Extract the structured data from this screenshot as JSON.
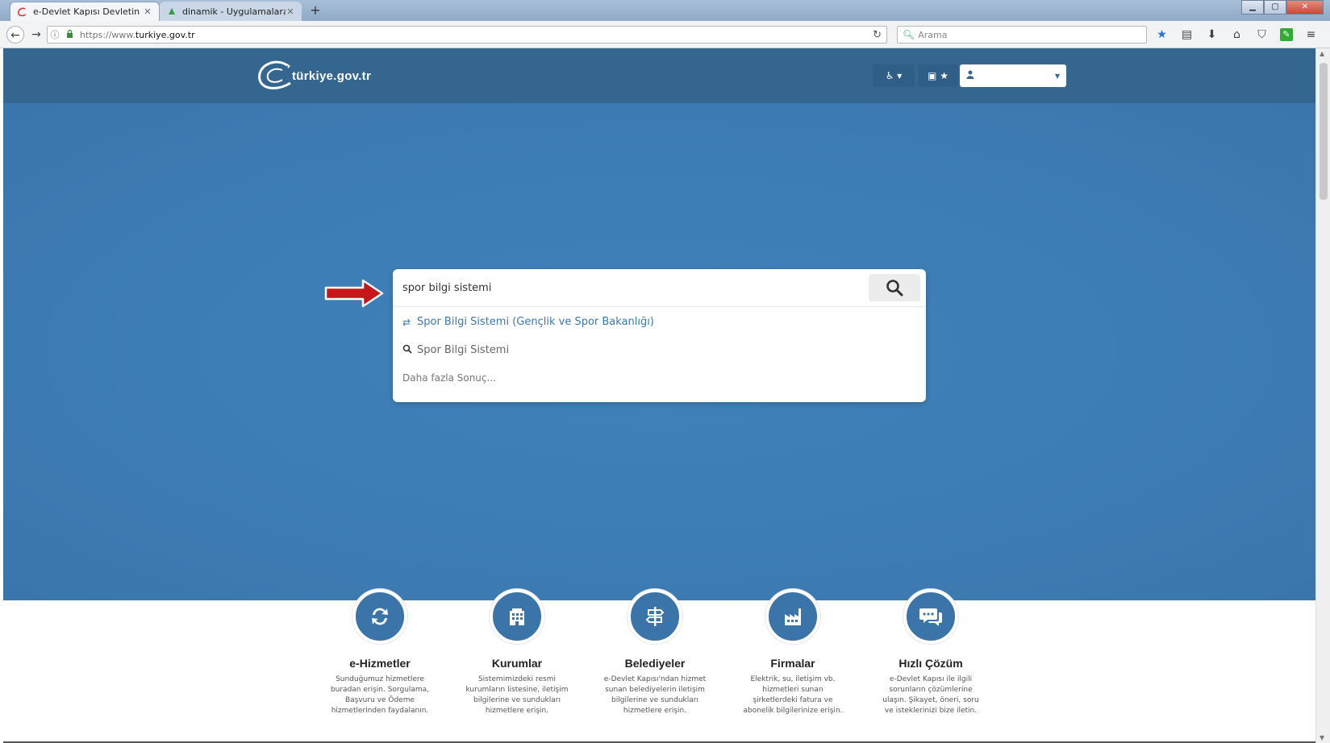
{
  "browser": {
    "tabs": [
      {
        "title": "e-Devlet Kapısı Devletin Kıs...",
        "active": true
      },
      {
        "title": "dinamik - Uygulamalara eri...",
        "active": false
      }
    ],
    "new_tab": "+",
    "url_prefix": "https://www.",
    "url_domain": "turkiye.gov.tr",
    "search_placeholder": "Arama"
  },
  "header": {
    "logo_text": "türkiye.gov.tr"
  },
  "search": {
    "query": "spor bilgi sistemi",
    "suggestions": [
      {
        "label": "Spor Bilgi Sistemi (Gençlik ve Spor Bakanlığı)",
        "icon": "refresh-icon"
      },
      {
        "label": "Spor Bilgi Sistemi",
        "icon": "search-icon"
      },
      {
        "label": "Daha fazla Sonuç...",
        "icon": ""
      }
    ]
  },
  "services": [
    {
      "title": "e-Hizmetler",
      "desc": "Sunduğumuz hizmetlere buradan erişin. Sorgulama, Başvuru ve Ödeme hizmetlerinden faydalanın.",
      "icon": "refresh-icon"
    },
    {
      "title": "Kurumlar",
      "desc": "Sistemimizdeki resmi kurumların listesine, iletişim bilgilerine ve sundukları hizmetlere erişin.",
      "icon": "building-icon"
    },
    {
      "title": "Belediyeler",
      "desc": "e-Devlet Kapısı'ndan hizmet sunan belediyelerin iletişim bilgilerine ve sundukları hizmetlere erişin.",
      "icon": "signpost-icon"
    },
    {
      "title": "Firmalar",
      "desc": "Elektrik, su, iletişim vb. hizmetleri sunan şirketlerdeki fatura ve abonelik bilgilerinize erişin.",
      "icon": "factory-icon"
    },
    {
      "title": "Hızlı Çözüm",
      "desc": "e-Devlet Kapısı ile ilgili sorunların çözümlerine ulaşın. Şikayet, öneri, soru ve isteklerinizi bize iletin.",
      "icon": "chat-icon"
    }
  ],
  "colors": {
    "header": "#34668f",
    "hero": "#3d7db5",
    "accent": "#3a74a8",
    "arrow": "#c8171a"
  }
}
